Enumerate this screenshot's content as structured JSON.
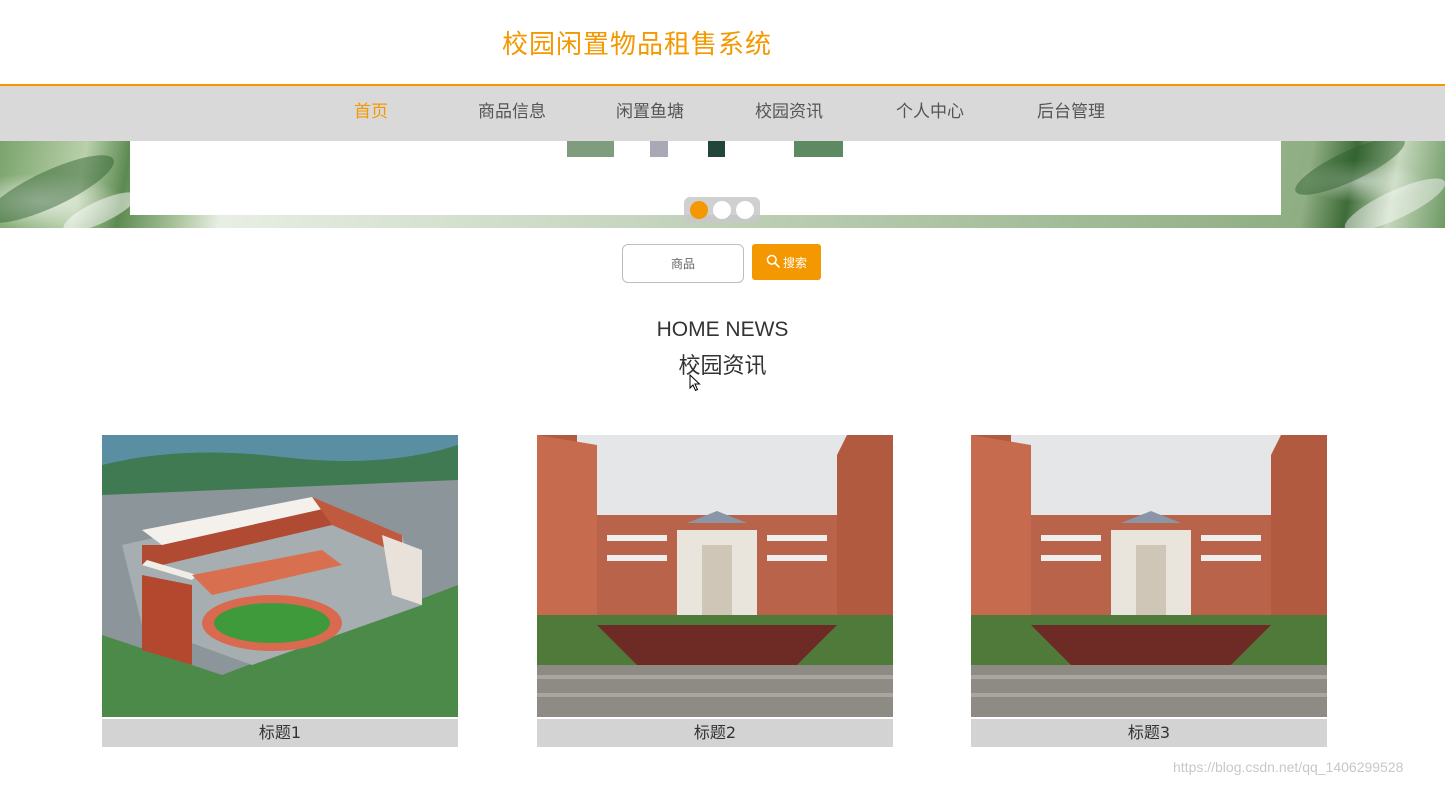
{
  "header": {
    "title": "校园闲置物品租售系统"
  },
  "nav": {
    "items": [
      {
        "label": "首页",
        "active": true
      },
      {
        "label": "商品信息",
        "active": false
      },
      {
        "label": "闲置鱼塘",
        "active": false
      },
      {
        "label": "校园资讯",
        "active": false
      },
      {
        "label": "个人中心",
        "active": false
      },
      {
        "label": "后台管理",
        "active": false
      }
    ]
  },
  "carousel": {
    "slide_count": 3,
    "active_index": 0
  },
  "search": {
    "value": "商品",
    "button_label": "搜索"
  },
  "news": {
    "heading_en": "HOME NEWS",
    "heading_cn": "校园资讯",
    "cards": [
      {
        "title": "标题1"
      },
      {
        "title": "标题2"
      },
      {
        "title": "标题3"
      }
    ]
  },
  "watermark": "https://blog.csdn.net/qq_1406299528",
  "colors": {
    "accent": "#f39800",
    "nav_bg": "#d9d9d9",
    "caption_bg": "#d3d3d3"
  }
}
